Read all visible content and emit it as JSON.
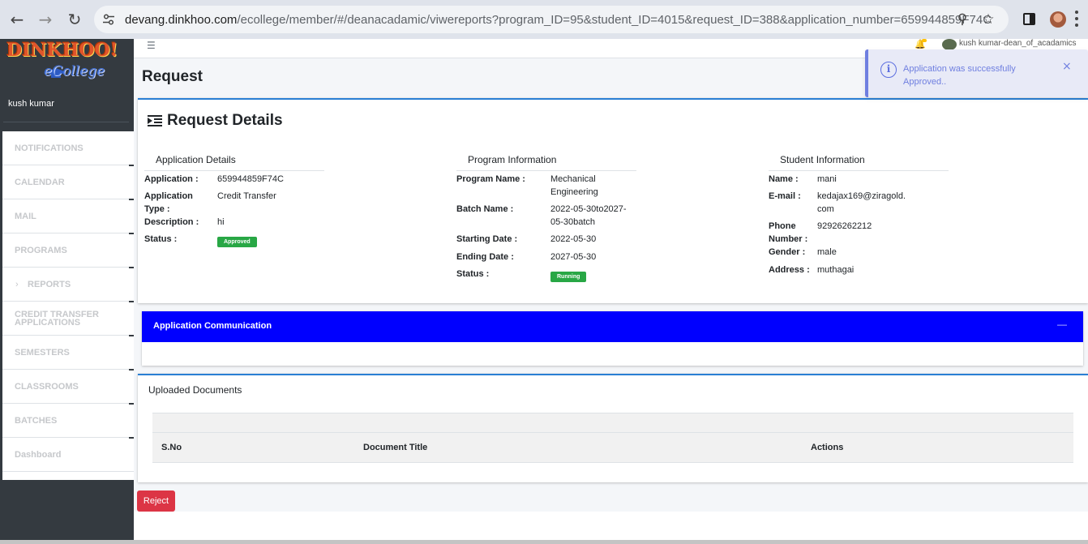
{
  "browser": {
    "url_host": "devang.dinkhoo.com",
    "url_path": "/ecollege/member/#/deanacadamic/viwereports?program_ID=95&student_ID=4015&request_ID=388&application_number=659944859F74C"
  },
  "sidebar": {
    "logo_main": "DINKHOO!",
    "logo_sub": "eCollege",
    "user_name": "kush kumar",
    "items": [
      {
        "label": "NOTIFICATIONS"
      },
      {
        "label": "CALENDAR"
      },
      {
        "label": "MAIL"
      },
      {
        "label": "PROGRAMS"
      },
      {
        "label": "REPORTS",
        "chevron": "›"
      },
      {
        "label": "CREDIT TRANSFER APPLICATIONS"
      },
      {
        "label": "SEMESTERS"
      },
      {
        "label": "CLASSROOMS"
      },
      {
        "label": "BATCHES"
      },
      {
        "label": "Dashboard"
      }
    ]
  },
  "topnav": {
    "user": "kush kumar-dean_of_acadamics"
  },
  "page": {
    "title": "Request",
    "details_title": "Request Details"
  },
  "application": {
    "heading": "Application Details",
    "rows": [
      {
        "key": "Application :",
        "value": "659944859F74C"
      },
      {
        "key": "Application Type :",
        "value": "Credit Transfer"
      },
      {
        "key": "Description :",
        "value": "hi"
      },
      {
        "key": "Status :",
        "value": "Approved"
      }
    ]
  },
  "program": {
    "heading": "Program Information",
    "rows": [
      {
        "key": "Program Name :",
        "value": "Mechanical Engineering"
      },
      {
        "key": "Batch Name :",
        "value": "2022-05-30to2027-05-30batch"
      },
      {
        "key": "Starting Date :",
        "value": "2022-05-30"
      },
      {
        "key": "Ending Date :",
        "value": "2027-05-30"
      },
      {
        "key": "Status :",
        "value": "Running"
      }
    ]
  },
  "student": {
    "heading": "Student Information",
    "rows": [
      {
        "key": "Name :",
        "value": "mani"
      },
      {
        "key": "E-mail :",
        "value": "kedajax169@ziragold.com"
      },
      {
        "key": "Phone Number :",
        "value": "92926262212"
      },
      {
        "key": "Gender :",
        "value": "male"
      },
      {
        "key": "Address :",
        "value": "muthagai"
      }
    ]
  },
  "communication": {
    "title": "Application Communication",
    "collapse_symbol": "—"
  },
  "documents": {
    "title": "Uploaded Documents",
    "columns": [
      "S.No",
      "Document Title",
      "Actions"
    ]
  },
  "actions": {
    "reject_label": "Reject"
  },
  "toast": {
    "message": "Application was successfully Approved..",
    "icon": "info-icon",
    "close": "×"
  },
  "colors": {
    "sidebar_bg": "#343a40",
    "comm_header": "#0000ff",
    "approved_badge": "#28a745",
    "reject_button": "#dc3545",
    "card_accent": "#2a7fd4"
  }
}
